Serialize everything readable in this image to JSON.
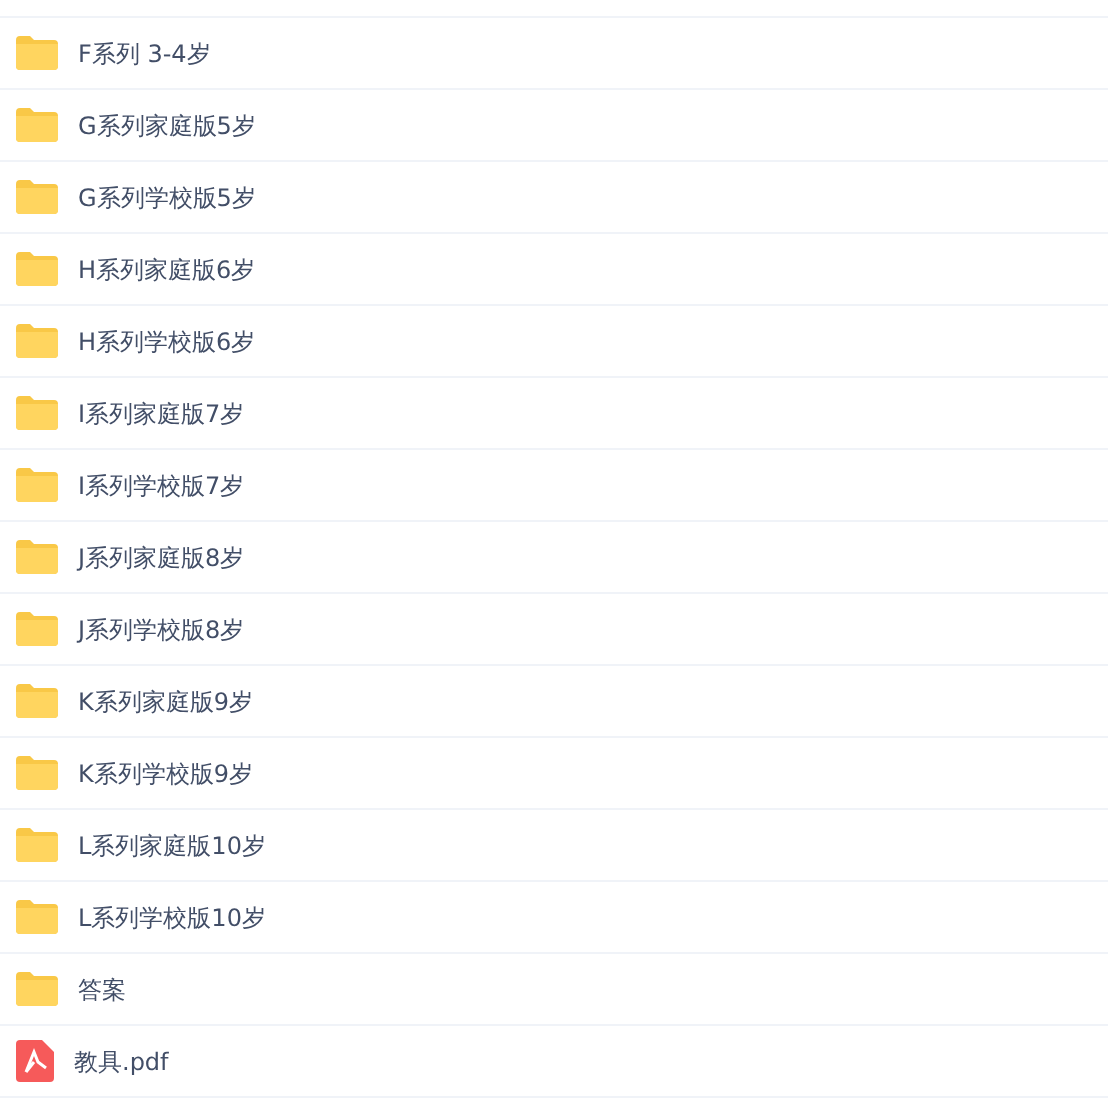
{
  "files": [
    {
      "name": "F系列 3-4岁",
      "kind": "folder"
    },
    {
      "name": "G系列家庭版5岁",
      "kind": "folder"
    },
    {
      "name": "G系列学校版5岁",
      "kind": "folder"
    },
    {
      "name": "H系列家庭版6岁",
      "kind": "folder"
    },
    {
      "name": "H系列学校版6岁",
      "kind": "folder"
    },
    {
      "name": "I系列家庭版7岁",
      "kind": "folder"
    },
    {
      "name": "I系列学校版7岁",
      "kind": "folder"
    },
    {
      "name": "J系列家庭版8岁",
      "kind": "folder"
    },
    {
      "name": "J系列学校版8岁",
      "kind": "folder"
    },
    {
      "name": "K系列家庭版9岁",
      "kind": "folder"
    },
    {
      "name": "K系列学校版9岁",
      "kind": "folder"
    },
    {
      "name": "L系列家庭版10岁",
      "kind": "folder"
    },
    {
      "name": "L系列学校版10岁",
      "kind": "folder"
    },
    {
      "name": "答案",
      "kind": "folder"
    },
    {
      "name": "教具.pdf",
      "kind": "pdf"
    }
  ]
}
